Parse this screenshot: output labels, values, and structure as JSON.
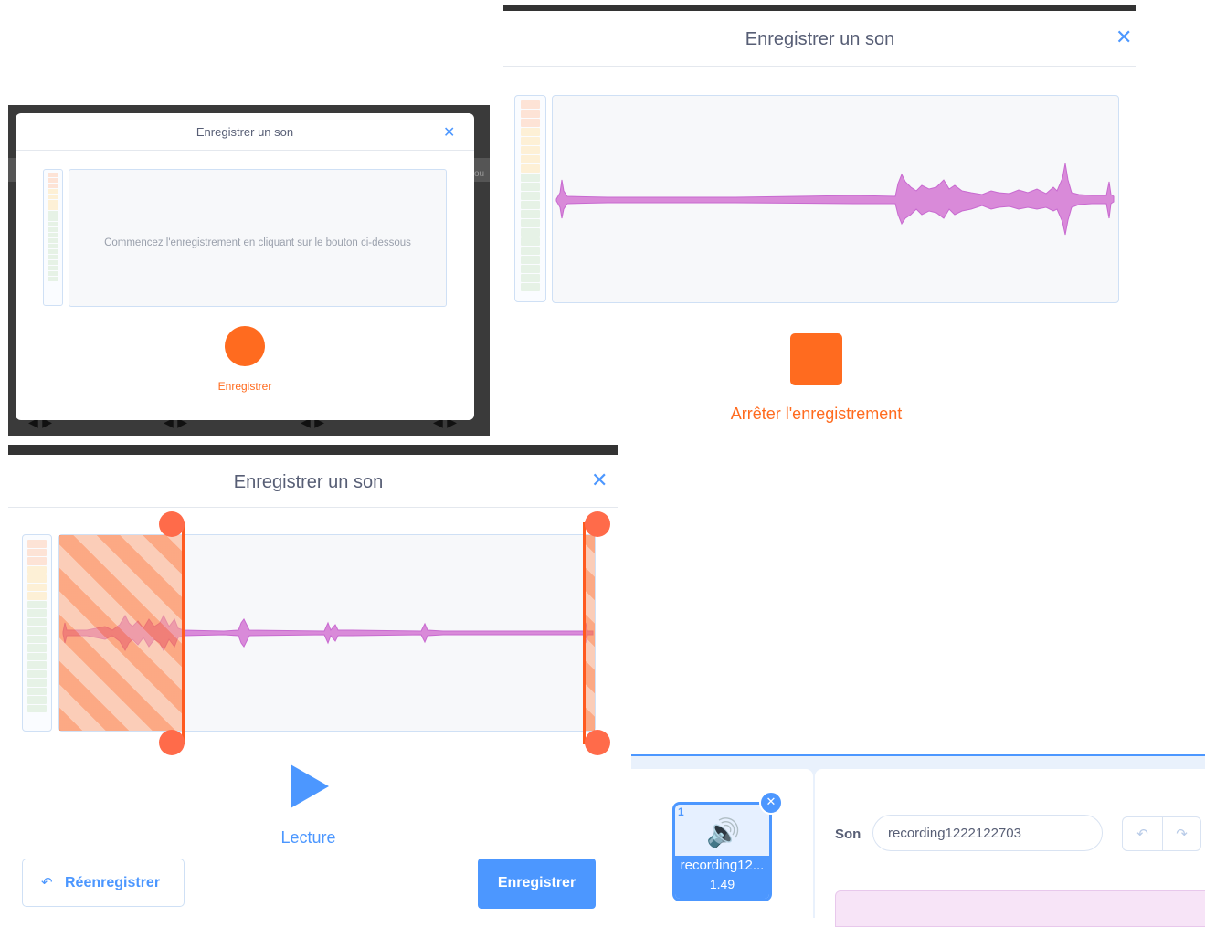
{
  "panel_a": {
    "title": "Enregistrer un son",
    "close_icon": "close-icon",
    "hint": "Commencez l'enregistrement en cliquant sur le bouton ci-dessous",
    "record_label": "Enregistrer",
    "ghost_side_text": "ou"
  },
  "panel_b": {
    "title": "Enregistrer un son",
    "close_icon": "close-icon",
    "stop_label": "Arrêter l'enregistrement"
  },
  "panel_c": {
    "title": "Enregistrer un son",
    "close_icon": "close-icon",
    "play_label": "Lecture",
    "rerecord_label": "Réenregistrer",
    "save_label": "Enregistrer"
  },
  "panel_d": {
    "sound_number": "1",
    "sound_name_short": "recording12...",
    "sound_duration": "1.49",
    "field_label": "Son",
    "sound_name_value": "recording1222122703"
  },
  "colors": {
    "accent": "#4c97ff",
    "record": "#ff6b1f",
    "waveform": "#d98ad9",
    "text": "#575e75"
  }
}
